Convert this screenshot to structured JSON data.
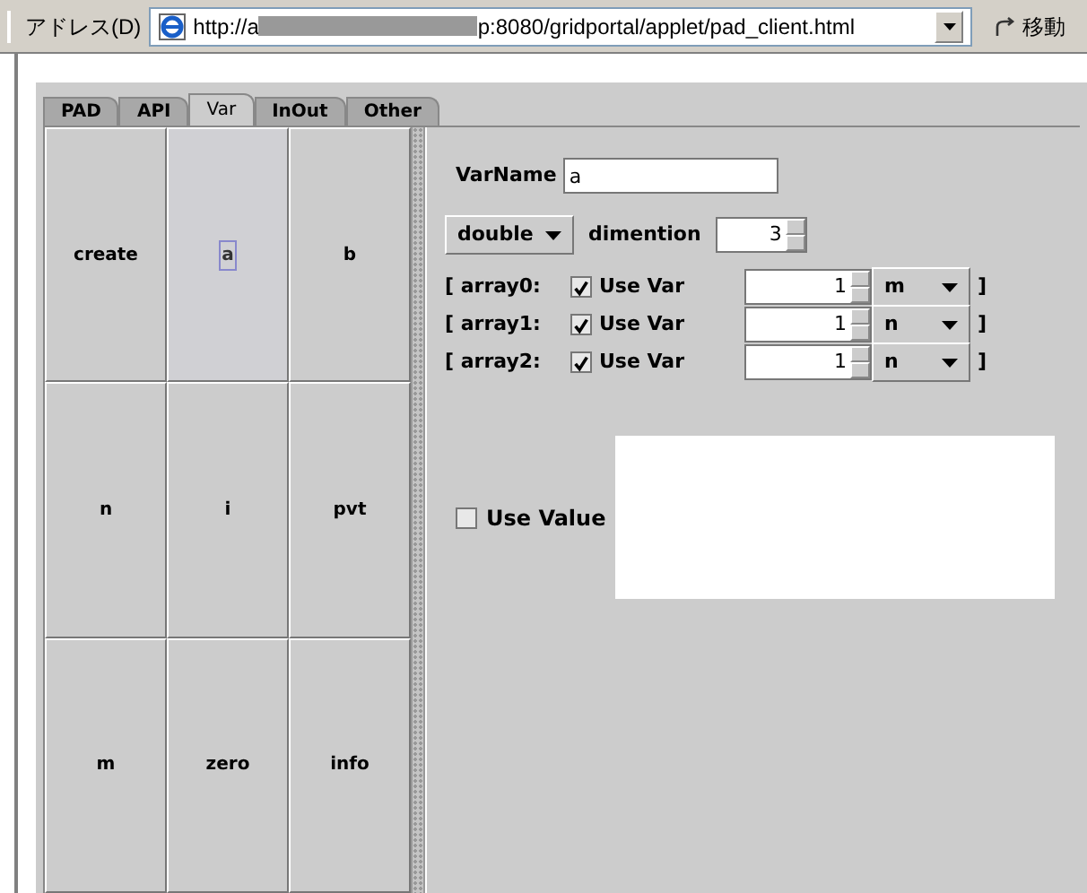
{
  "address_bar": {
    "label": "アドレス(D)",
    "url_start": "http://a",
    "url_end": "p:8080/gridportal/applet/pad_client.html",
    "go": "移動"
  },
  "tabs": [
    {
      "label": "PAD",
      "selected": false
    },
    {
      "label": "API",
      "selected": false
    },
    {
      "label": "Var",
      "selected": true
    },
    {
      "label": "InOut",
      "selected": false
    },
    {
      "label": "Other",
      "selected": false
    }
  ],
  "var_buttons": [
    {
      "label": "create",
      "selected": false
    },
    {
      "label": "a",
      "selected": true
    },
    {
      "label": "b",
      "selected": false
    },
    {
      "label": "n",
      "selected": false
    },
    {
      "label": "i",
      "selected": false
    },
    {
      "label": "pvt",
      "selected": false
    },
    {
      "label": "m",
      "selected": false
    },
    {
      "label": "zero",
      "selected": false
    },
    {
      "label": "info",
      "selected": false
    }
  ],
  "var_name": {
    "label": "VarName",
    "value": "a"
  },
  "type": "double",
  "dimension": {
    "label": "dimention",
    "value": "3"
  },
  "arrays": [
    {
      "label": "[ array0:",
      "use_var": {
        "label": "Use Var",
        "checked": true
      },
      "size": "1",
      "var": "m",
      "close": "]"
    },
    {
      "label": "[ array1:",
      "use_var": {
        "label": "Use Var",
        "checked": true
      },
      "size": "1",
      "var": "n",
      "close": "]"
    },
    {
      "label": "[ array2:",
      "use_var": {
        "label": "Use Var",
        "checked": true
      },
      "size": "1",
      "var": "n",
      "close": "]"
    }
  ],
  "use_value": {
    "label": "Use Value",
    "checked": false
  }
}
